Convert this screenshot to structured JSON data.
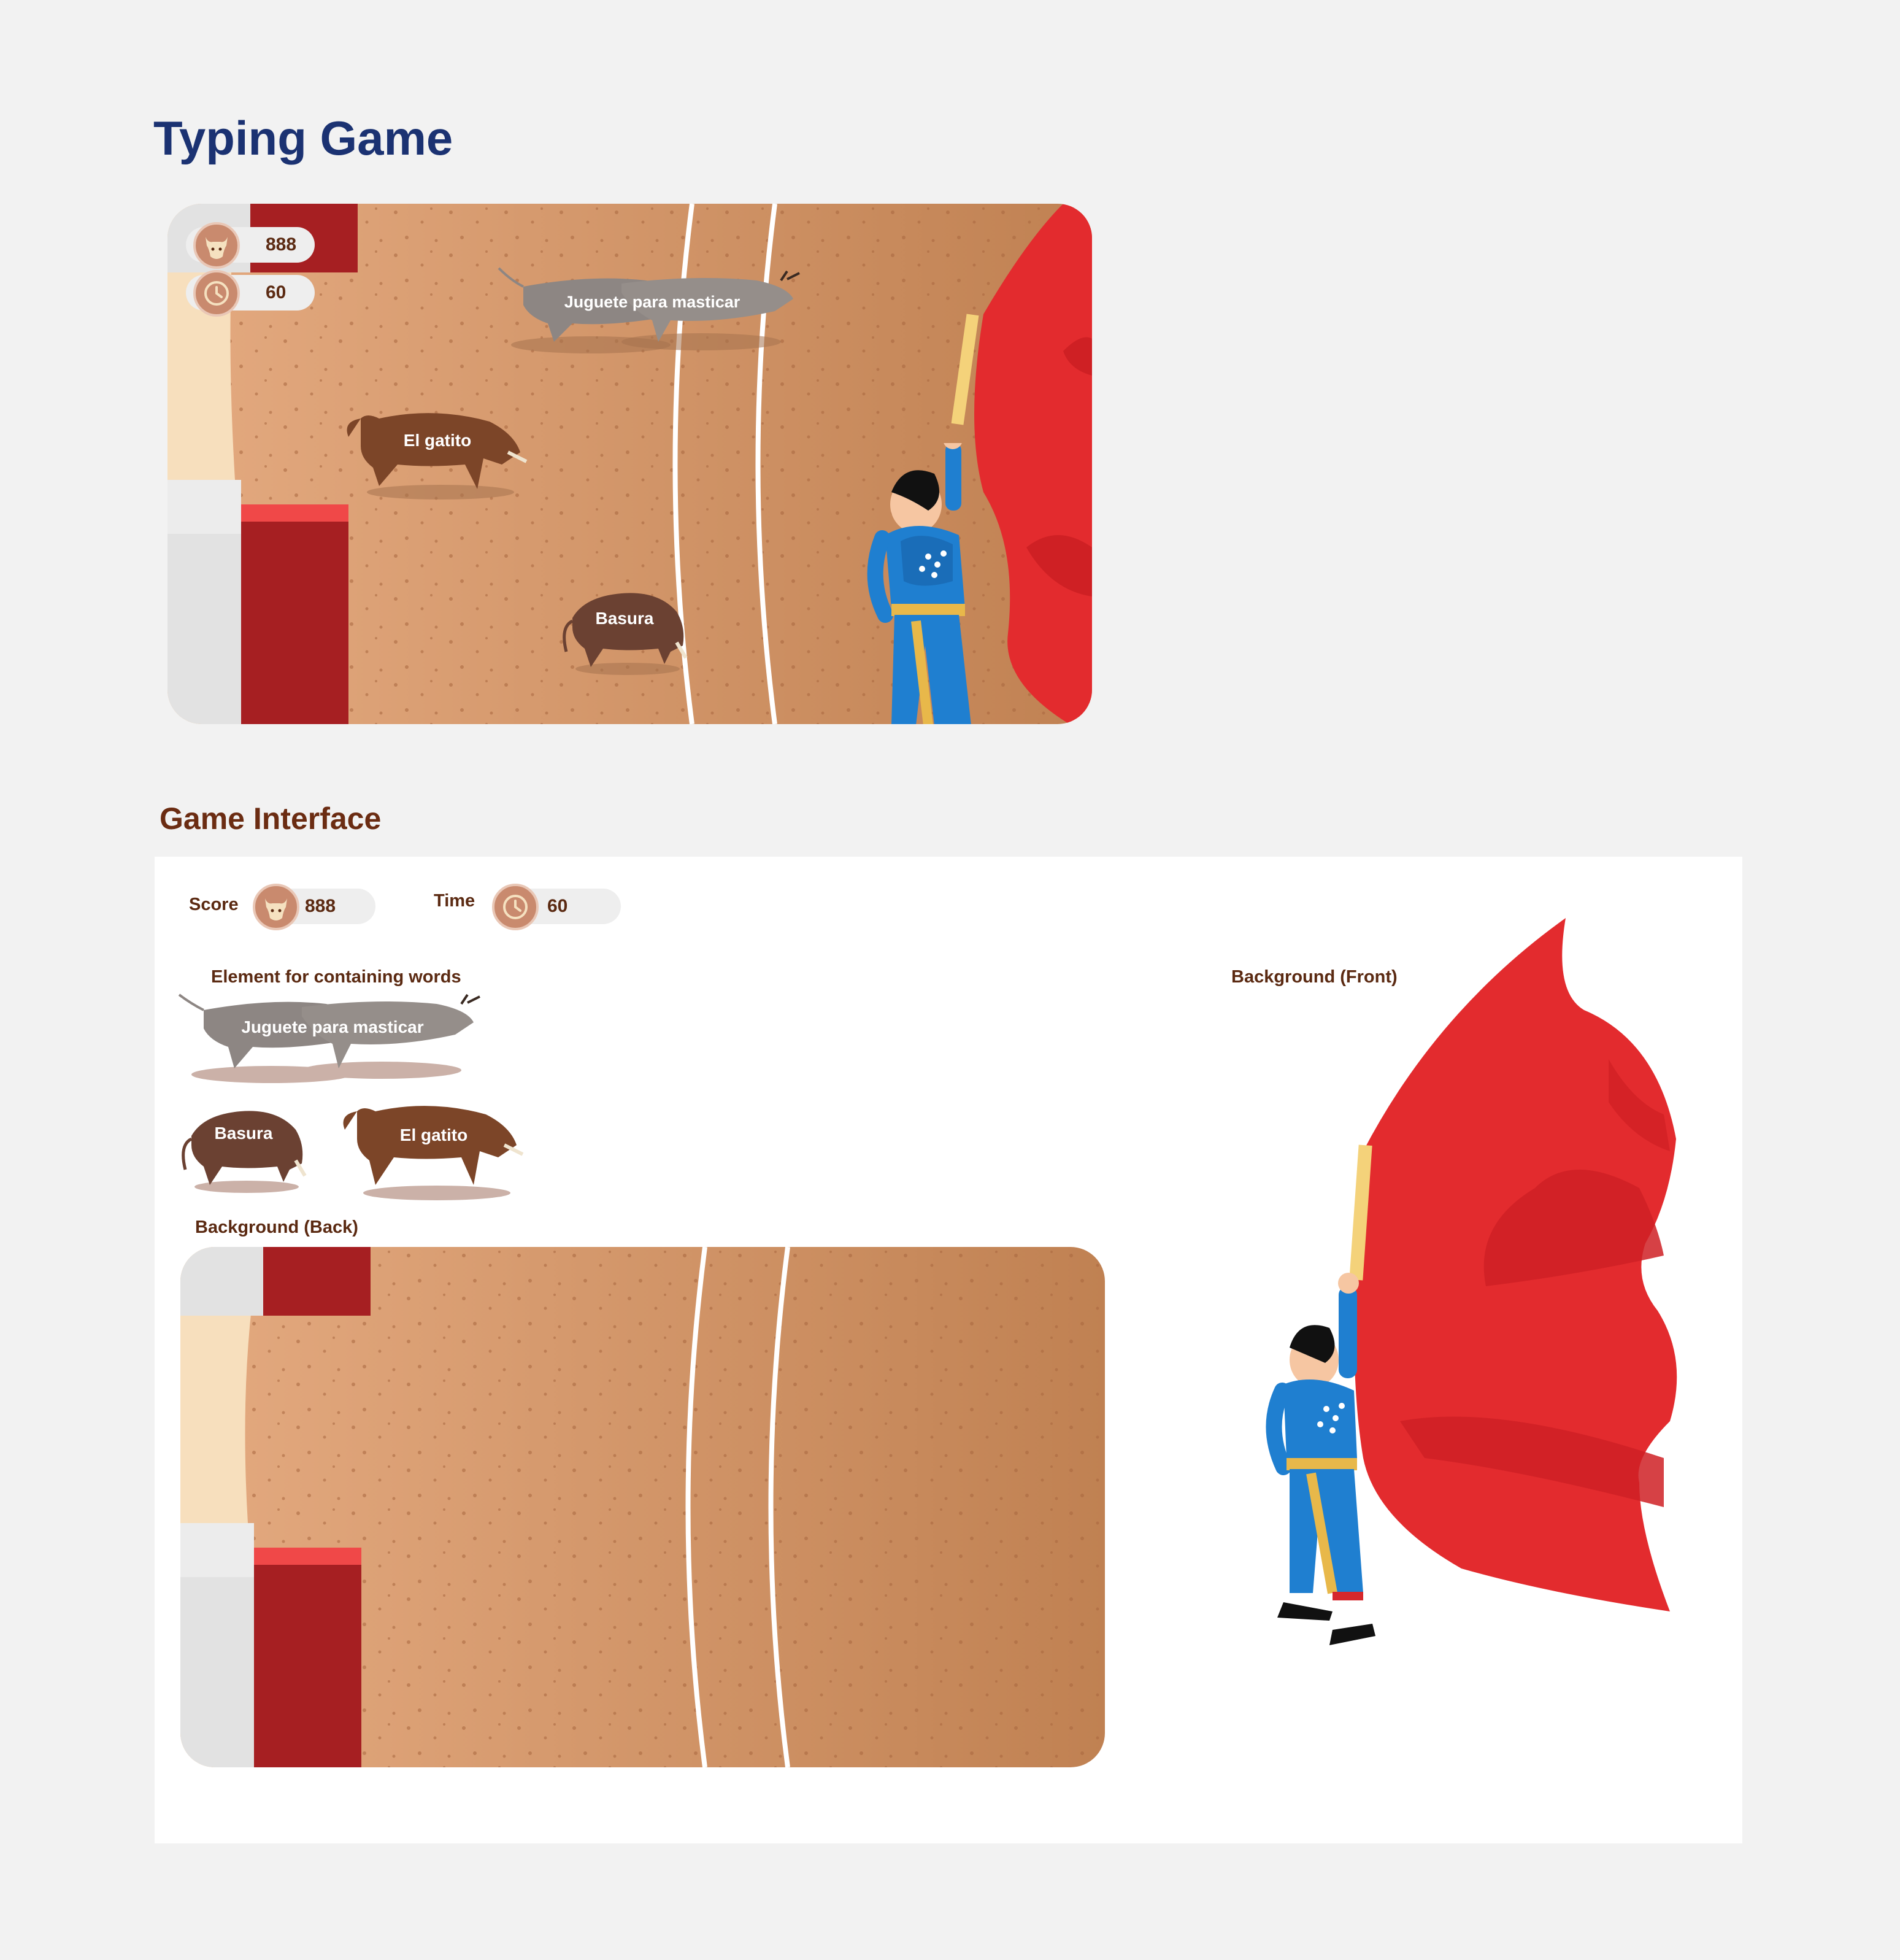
{
  "page_title": "Typing Game",
  "section_title": "Game Interface",
  "hud": {
    "score_label": "Score",
    "score_value": "888",
    "score_icon": "bull-head-icon",
    "time_label": "Time",
    "time_value": "60",
    "time_icon": "clock-icon"
  },
  "game": {
    "words": [
      "Juguete para masticar",
      "El gatito",
      "Basura"
    ]
  },
  "interface": {
    "words_label": "Element for containing words",
    "back_label": "Background (Back)",
    "front_label": "Background (Front)",
    "words": {
      "grey": "Juguete para masticar",
      "dark": "Basura",
      "brown": "El gatito"
    }
  },
  "colors": {
    "title_blue": "#1b3272",
    "label_brown": "#6b2c12",
    "arena_sand_light": "#e3a87e",
    "arena_sand_dark": "#bf7f50",
    "barrier_red": "#a61f22",
    "cape_red": "#e32b2e",
    "matador_blue": "#1f7fd0"
  }
}
